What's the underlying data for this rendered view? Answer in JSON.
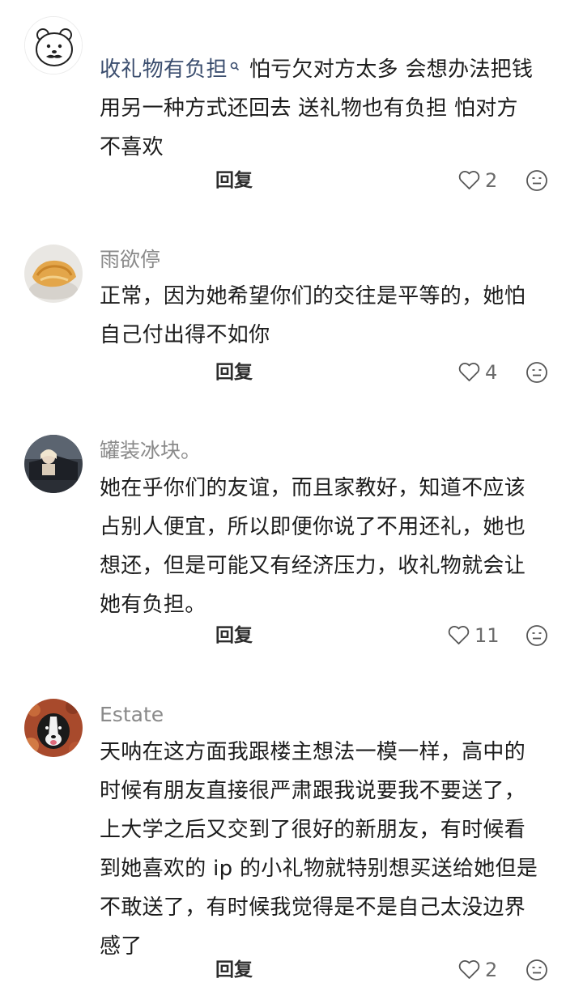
{
  "comments": [
    {
      "username": "",
      "inline_user": "收礼物有负担",
      "lines": [
        "怕亏欠对方太多 会想办法把钱",
        "用另一种方式还回去 送礼物也有负担 怕对方",
        "不喜欢"
      ],
      "reply_label": "回复",
      "likes": "2",
      "avatar_icon": "polar-bear-mustache-avatar"
    },
    {
      "username": "雨欲停",
      "lines": [
        "正常，因为她希望你们的交往是平等的，她怕",
        "自己付出得不如你"
      ],
      "reply_label": "回复",
      "likes": "4",
      "avatar_icon": "pastry-photo-avatar"
    },
    {
      "username": "罐装冰块。",
      "lines": [
        "她在乎你们的友谊，而且家教好，知道不应该",
        "占别人便宜，所以即便你说了不用还礼，她也",
        "想还，但是可能又有经济压力，收礼物就会让",
        "她有负担。"
      ],
      "reply_label": "回复",
      "likes": "11",
      "avatar_icon": "person-in-car-avatar"
    },
    {
      "username": "Estate",
      "lines": [
        "天呐在这方面我跟楼主想法一模一样，高中的",
        "时候有朋友直接很严肃跟我说要我不要送了，",
        "上大学之后又交到了很好的新朋友，有时候看",
        "到她喜欢的 ip 的小礼物就特别想买送给她但是",
        "不敢送了，有时候我觉得是不是自己太没边界",
        "感了"
      ],
      "reply_label": "回复",
      "likes": "2",
      "avatar_icon": "dog-in-leaves-avatar"
    }
  ],
  "icons": {
    "like": "heart-outline-icon",
    "emoji": "smiley-face-icon"
  }
}
